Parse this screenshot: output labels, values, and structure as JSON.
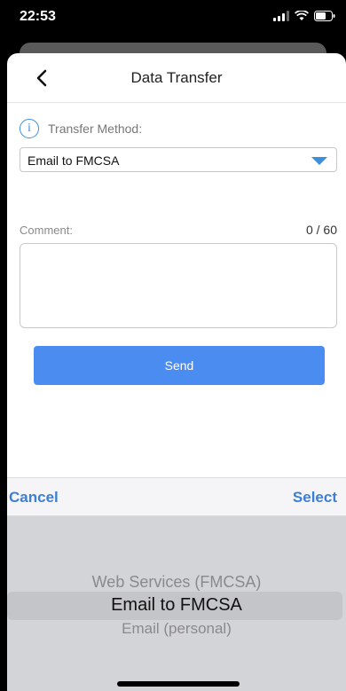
{
  "status_bar": {
    "time": "22:53"
  },
  "header": {
    "title": "Data Transfer"
  },
  "transfer_method": {
    "label": "Transfer Method:",
    "value": "Email to FMCSA"
  },
  "comment": {
    "label": "Comment:",
    "counter": "0 / 60",
    "value": ""
  },
  "send_label": "Send",
  "picker": {
    "cancel_label": "Cancel",
    "select_label": "Select",
    "options": [
      "Web Services (FMCSA)",
      "Email to FMCSA",
      "Email (personal)"
    ],
    "selected_index": 1
  },
  "colors": {
    "accent": "#3b7fd6",
    "button": "#4b8cf1",
    "picker_bg": "#d3d4d8"
  },
  "icons": [
    "back-icon",
    "info-icon",
    "dropdown-icon",
    "signal-icon",
    "wifi-icon",
    "battery-icon"
  ]
}
